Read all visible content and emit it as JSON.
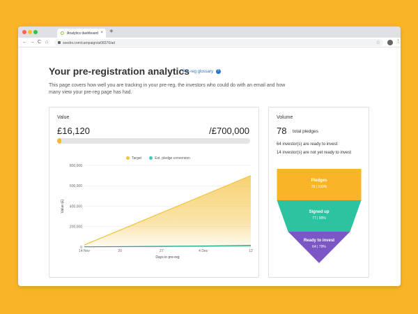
{
  "browser": {
    "tab_title": "Analytics dashboard",
    "tab_close": "×",
    "new_tab": "+",
    "url": "seedrs.com/campaign/ai08376/ad",
    "nav_back": "←",
    "nav_forward": "→",
    "nav_reload": "C",
    "nav_home": "⌂",
    "bookmark": "☆",
    "menu": "⋮"
  },
  "page": {
    "title": "Your pre-registration analytics",
    "glossary_link": "Pre-reg glossary",
    "help_glyph": "?",
    "description": "This page covers how well you are tracking in your pre-reg, the investors who could do with an email and how many view your pre-reg page has had."
  },
  "value_card": {
    "label": "Value",
    "amount": "£16,120",
    "target": "/£700,000",
    "progress_fraction": 0.023,
    "legend": [
      {
        "label": "Target",
        "color": "#f5c342"
      },
      {
        "label": "Est. pledge conversion",
        "color": "#3ecdb1"
      }
    ]
  },
  "chart_data": {
    "type": "area",
    "title": "",
    "xlabel": "Days in pre-reg",
    "ylabel": "Value (£)",
    "x_ticks": [
      "14 Nov",
      "20",
      "27",
      "4 Dec",
      "12"
    ],
    "y_ticks": [
      "0",
      "200,000",
      "400,000",
      "600,000",
      "800,000"
    ],
    "ylim": [
      0,
      800000
    ],
    "grid": true,
    "legend_position": "top",
    "series": [
      {
        "name": "Target",
        "color": "#f5c342",
        "x": [
          0,
          28
        ],
        "values": [
          20000,
          700000
        ]
      },
      {
        "name": "Est. pledge conversion",
        "color": "#3ecdb1",
        "x": [
          0,
          6,
          13,
          20,
          28
        ],
        "values": [
          2000,
          4000,
          7000,
          10000,
          16120
        ]
      }
    ]
  },
  "volume_card": {
    "label": "Volume",
    "total": "78",
    "total_label": "total pledges",
    "ready_line": "64 investor(s) are ready to invest",
    "not_ready_line": "14 investor(s) are not yet ready to invest",
    "funnel": [
      {
        "title": "Pledges",
        "sub": "78 | 100%",
        "color": "#f9b527"
      },
      {
        "title": "Signed up",
        "sub": "77 | 99%",
        "color": "#2cc3a0"
      },
      {
        "title": "Ready to invest",
        "sub": "64 | 79%",
        "color": "#7b57c6"
      }
    ]
  }
}
